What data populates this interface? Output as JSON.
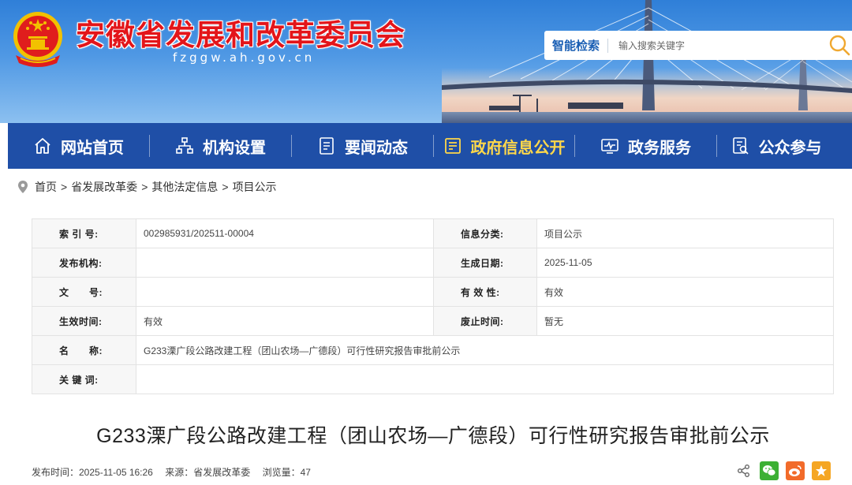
{
  "header": {
    "site_title": "安徽省发展和改革委员会",
    "domain": "fzggw.ah.gov.cn",
    "search": {
      "label": "智能检索",
      "placeholder": "输入搜索关键字"
    }
  },
  "nav": {
    "items": [
      {
        "label": "网站首页",
        "icon": "home-icon",
        "active": false
      },
      {
        "label": "机构设置",
        "icon": "org-chart-icon",
        "active": false
      },
      {
        "label": "要闻动态",
        "icon": "news-icon",
        "active": false
      },
      {
        "label": "政府信息公开",
        "icon": "gov-info-icon",
        "active": true
      },
      {
        "label": "政务服务",
        "icon": "service-monitor-icon",
        "active": false
      },
      {
        "label": "公众参与",
        "icon": "participation-icon",
        "active": false
      }
    ],
    "colors": {
      "background": "#1f4fa7",
      "active_text": "#ffd84a",
      "text": "#ffffff"
    }
  },
  "breadcrumb": [
    "首页",
    "省发展改革委",
    "其他法定信息",
    "项目公示"
  ],
  "info": {
    "index_label": "索 引 号:",
    "index_value": "002985931/202511-00004",
    "category_label": "信息分类:",
    "category_value": "项目公示",
    "publisher_label": "发布机构:",
    "publisher_value": "",
    "date_label": "生成日期:",
    "date_value": "2025-11-05",
    "doc_no_label_a": "文",
    "doc_no_label_b": "号:",
    "doc_no_value": "",
    "validity_label": "有 效 性:",
    "validity_value": "有效",
    "effective_label": "生效时间:",
    "effective_value": "有效",
    "abolish_label": "废止时间:",
    "abolish_value": "暂无",
    "name_label_a": "名",
    "name_label_b": "称:",
    "name_value": "G233溧广段公路改建工程（团山农场—广德段）可行性研究报告审批前公示",
    "keywords_label": "关 键 词:",
    "keywords_value": ""
  },
  "article": {
    "title": "G233溧广段公路改建工程（团山农场—广德段）可行性研究报告审批前公示",
    "publish_time": "发布时间：2025-11-05 16:26",
    "source": "来源：省发展改革委",
    "views": "浏览量：47"
  },
  "share": {
    "icons": [
      "share-icon",
      "wechat-icon",
      "weibo-icon",
      "favorite-icon"
    ]
  },
  "colors": {
    "title_red": "#e3151a",
    "nav_blue": "#1f4fa7",
    "wechat_green": "#3cb034",
    "weibo_orange": "#f26b2a",
    "favorite_yellow": "#f5a623"
  }
}
